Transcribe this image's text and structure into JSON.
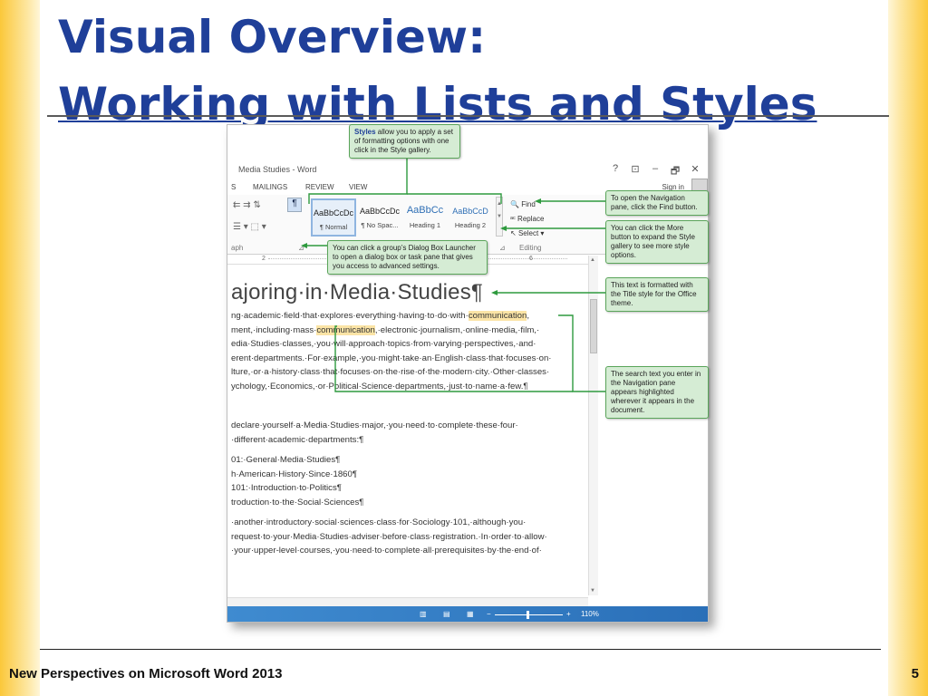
{
  "slide": {
    "title_line1": "Visual Overview:",
    "title_line2": "Working with Lists and Styles",
    "footer": "New Perspectives on Microsoft Word 2013",
    "page_number": "5"
  },
  "word": {
    "window_title": "Media Studies - Word",
    "window_controls": [
      "?",
      "⊡",
      "–",
      "🗗",
      "✕"
    ],
    "menu": [
      "S",
      "MAILINGS",
      "REVIEW",
      "VIEW"
    ],
    "sign_in": "Sign in",
    "styles": [
      {
        "preview": "AaBbCcDc",
        "name": "¶ Normal"
      },
      {
        "preview": "AaBbCcDc",
        "name": "¶ No Spac..."
      },
      {
        "preview": "AaBbCc",
        "name": "Heading 1"
      },
      {
        "preview": "AaBbCcD",
        "name": "Heading 2"
      }
    ],
    "editing": {
      "find": "Find",
      "replace": "Replace",
      "select": "Select",
      "group": "Editing"
    },
    "group_label_left": "aph",
    "ruler": [
      "2",
      "6"
    ],
    "document": {
      "title": "ajoring·in·Media·Studies¶",
      "para1": [
        {
          "pre": "ng·academic·field·that·explores·everything·having·to·do·with·",
          "hl": "communication",
          "post": ","
        },
        {
          "pre": "ment,·including·mass·",
          "hl": "communication",
          "post": ",·electronic·journalism,·online·media,·film,·"
        },
        {
          "pre": "edia·Studies·classes,·you·will·approach·topics·from·varying·perspectives,·and·",
          "hl": "",
          "post": ""
        },
        {
          "pre": "erent·departments.·For·example,·you·might·take·an·English·class·that·focuses·on·",
          "hl": "",
          "post": ""
        },
        {
          "pre": "lture,·or·a·history·class·that·focuses·on·the·rise·of·the·modern·city.·Other·classes·",
          "hl": "",
          "post": ""
        },
        {
          "pre": "ychology,·Economics,·or·Political·Science·departments,·just·to·name·a·few.¶",
          "hl": "",
          "post": ""
        }
      ],
      "para2": [
        "declare·yourself·a·Media·Studies·major,·you·need·to·complete·these·four·",
        "·different·academic·departments:¶"
      ],
      "list": [
        "01:·General·Media·Studies¶",
        "h·American·History·Since·1860¶",
        "101:·Introduction·to·Politics¶",
        "troduction·to·the·Social·Sciences¶"
      ],
      "para3": [
        "·another·introductory·social·sciences·class·for·Sociology·101,·although·you·",
        "request·to·your·Media·Studies·adviser·before·class·registration.·In·order·to·allow·",
        "·your·upper-level·courses,·you·need·to·complete·all·prerequisites·by·the·end·of·"
      ]
    },
    "zoom": "110%"
  },
  "callouts": {
    "styles_bold": "Styles",
    "styles_rest": " allow you to apply a set of formatting options with one click in the Style gallery.",
    "find": "To open the Navigation pane, click the Find button.",
    "more": "You can click the More button to expand the Style gallery to see more style options.",
    "dialog": "You can click a group’s Dialog Box Launcher to open a dialog box or task pane that gives you access to advanced settings.",
    "title": "This text is formatted with the Title style for the Office theme.",
    "search": "The search text you enter in the Navigation pane appears highlighted wherever it appears in the document."
  },
  "colors": {
    "title_blue": "#1f3f99",
    "callout_fill": "#d5ecd4",
    "callout_border": "#5aa55a",
    "highlight": "#fbe4a6",
    "status_blue": "#2a6fb8"
  }
}
